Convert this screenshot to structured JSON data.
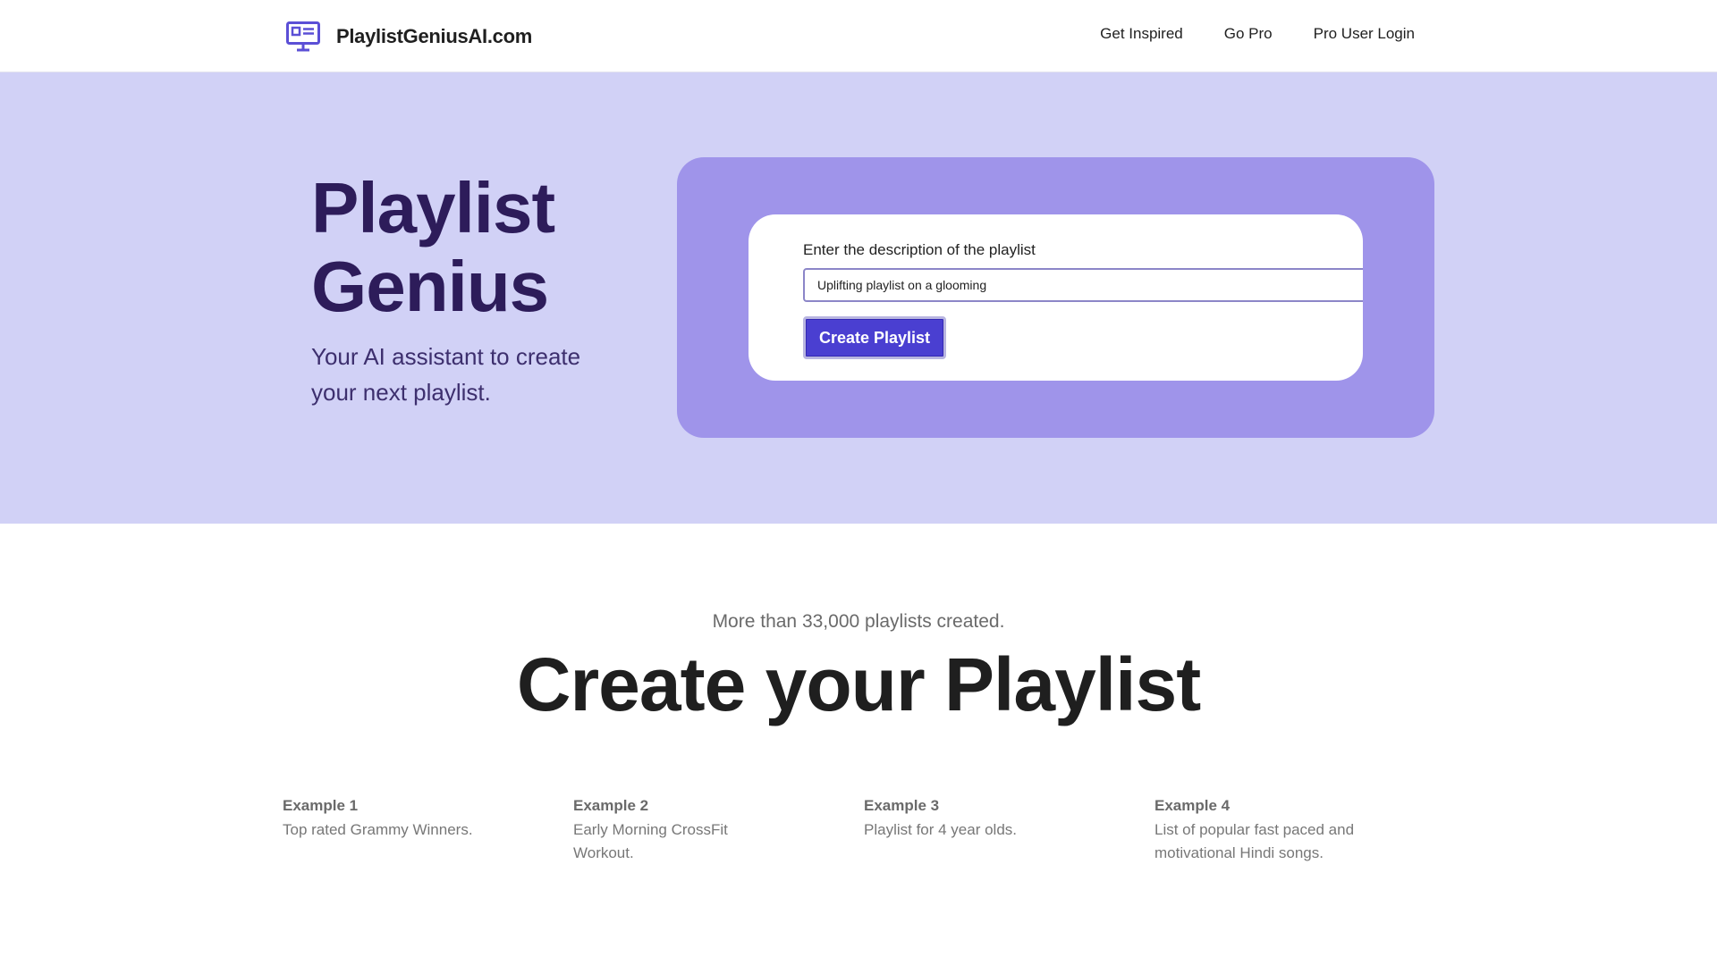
{
  "header": {
    "brand_name": "PlaylistGeniusAI.com",
    "brand_icon": "monitor-icon",
    "nav": [
      {
        "label": "Get Inspired"
      },
      {
        "label": "Go Pro"
      },
      {
        "label": "Pro User Login"
      }
    ]
  },
  "hero": {
    "title_line1": "Playlist",
    "title_line2": "Genius",
    "subtitle": "Your AI assistant to create your next playlist.",
    "form": {
      "label": "Enter the description of the playlist",
      "input_value": "Uplifting playlist on a glooming",
      "button_label": "Create Playlist"
    }
  },
  "section": {
    "stats": "More than 33,000 playlists created.",
    "title": "Create your Playlist",
    "examples": [
      {
        "title": "Example 1",
        "text": "Top rated Grammy Winners."
      },
      {
        "title": "Example 2",
        "text": "Early Morning CrossFit Workout."
      },
      {
        "title": "Example 3",
        "text": "Playlist for 4 year olds."
      },
      {
        "title": "Example 4",
        "text": "List of popular fast paced and motivational Hindi songs."
      }
    ]
  },
  "colors": {
    "hero_bg": "#d1d1f6",
    "panel_bg": "#9f94ea",
    "button_bg": "#4a3fd1",
    "title_color": "#2d1c5a",
    "icon_color": "#5b4fd6"
  }
}
